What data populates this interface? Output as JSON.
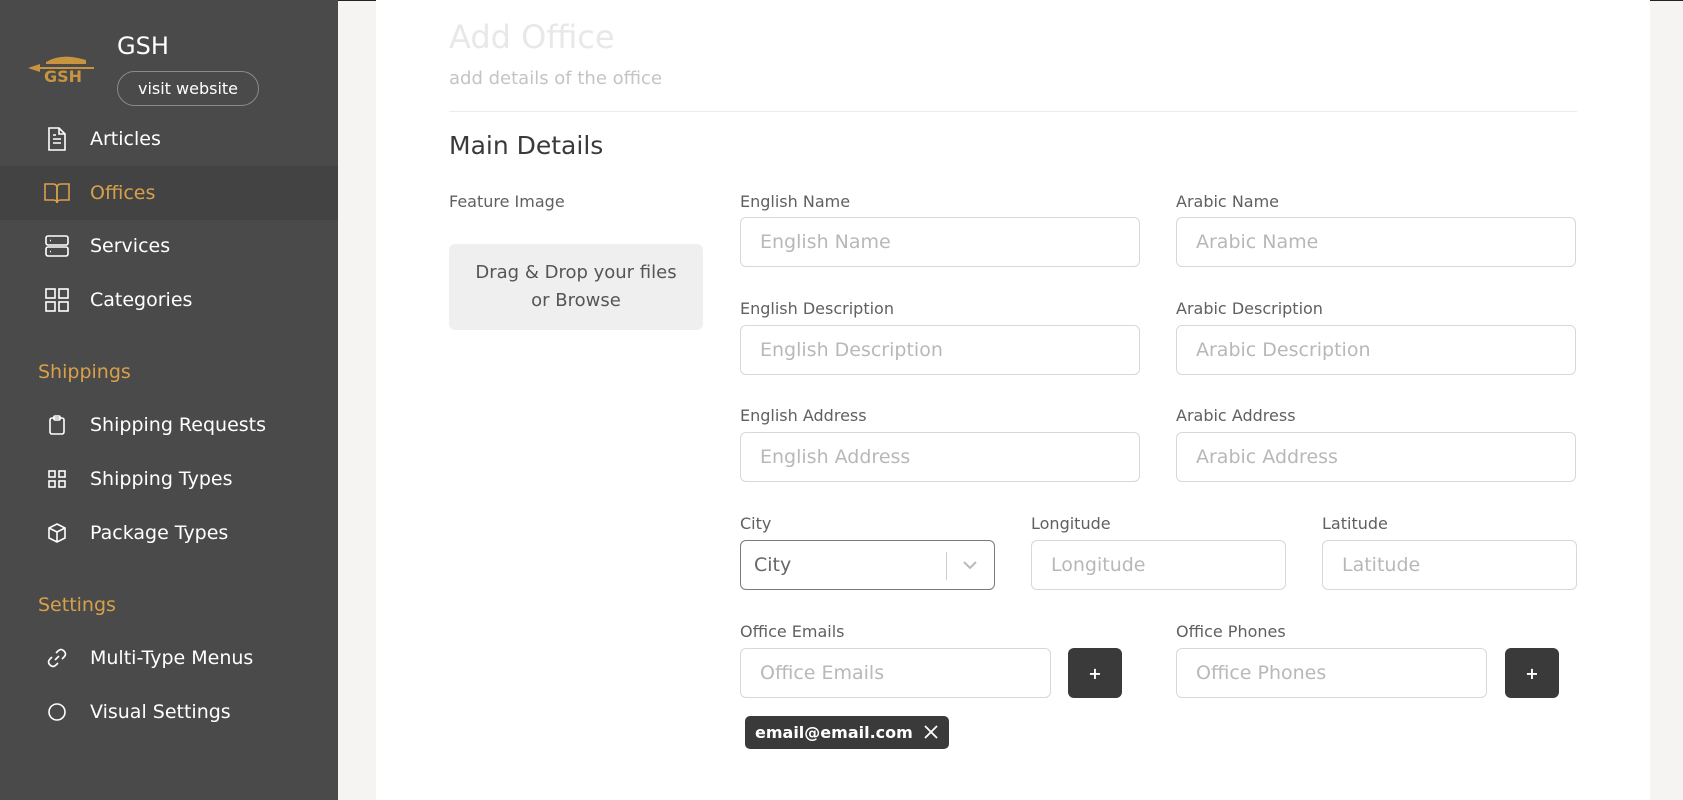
{
  "brand": {
    "name": "GSH",
    "visit_label": "visit website"
  },
  "sidebar": {
    "items": [
      {
        "label": "Articles",
        "icon": "document-icon"
      },
      {
        "label": "Offices",
        "icon": "book-icon",
        "active": true
      },
      {
        "label": "Services",
        "icon": "server-icon"
      },
      {
        "label": "Categories",
        "icon": "grid-icon"
      }
    ],
    "shippings_title": "Shippings",
    "shippings": [
      {
        "label": "Shipping Requests",
        "icon": "clipboard-icon"
      },
      {
        "label": "Shipping Types",
        "icon": "grid-small-icon"
      },
      {
        "label": "Package Types",
        "icon": "box-icon"
      }
    ],
    "settings_title": "Settings",
    "settings": [
      {
        "label": "Multi-Type Menus",
        "icon": "link-icon"
      },
      {
        "label": "Visual Settings",
        "icon": "circle-icon"
      }
    ]
  },
  "header": {
    "title": "Add Office",
    "subtitle": "add details of the office"
  },
  "main": {
    "section_title": "Main Details",
    "feature_image_label": "Feature Image",
    "dropzone_text": "Drag & Drop your files or Browse",
    "english_name": {
      "label": "English Name",
      "placeholder": "English Name"
    },
    "arabic_name": {
      "label": "Arabic Name",
      "placeholder": "Arabic Name"
    },
    "english_description": {
      "label": "English Description",
      "placeholder": "English Description"
    },
    "arabic_description": {
      "label": "Arabic Description",
      "placeholder": "Arabic Description"
    },
    "english_address": {
      "label": "English Address",
      "placeholder": "English Address"
    },
    "arabic_address": {
      "label": "Arabic Address",
      "placeholder": "Arabic Address"
    },
    "city": {
      "label": "City",
      "value": "City"
    },
    "longitude": {
      "label": "Longitude",
      "placeholder": "Longitude"
    },
    "latitude": {
      "label": "Latitude",
      "placeholder": "Latitude"
    },
    "office_emails": {
      "label": "Office Emails",
      "placeholder": "Office Emails",
      "add_label": "+"
    },
    "office_phones": {
      "label": "Office Phones",
      "placeholder": "Office Phones",
      "add_label": "+"
    },
    "email_chips": [
      "email@email.com"
    ]
  },
  "colors": {
    "sidebar_bg": "#4a4a4a",
    "accent": "#d9a04a",
    "button_dark": "#3a3a3a"
  }
}
